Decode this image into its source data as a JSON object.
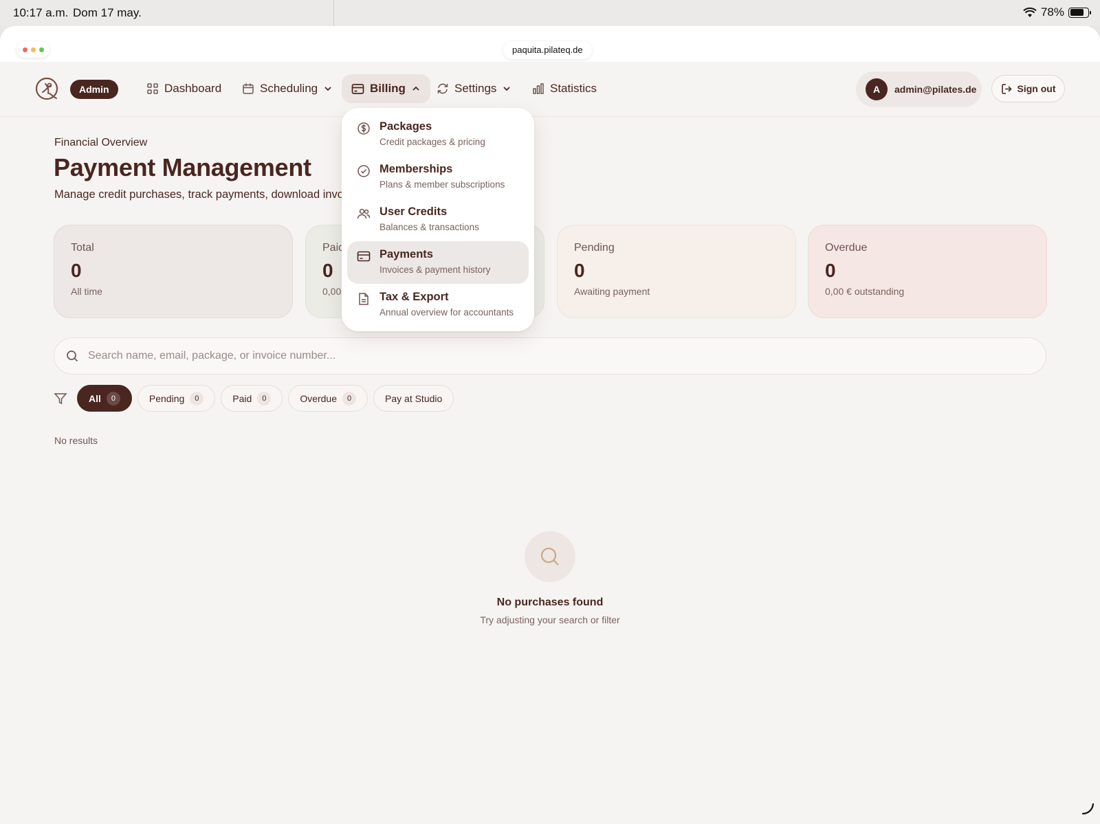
{
  "status_bar": {
    "time": "10:17 a.m.",
    "date": "Dom 17 may.",
    "battery": "78%"
  },
  "browser": {
    "url": "paquita.pilateq.de"
  },
  "nav": {
    "badge": "Admin",
    "items": [
      {
        "label": "Dashboard",
        "icon": "grid-icon"
      },
      {
        "label": "Scheduling",
        "icon": "calendar-icon"
      },
      {
        "label": "Billing",
        "icon": "credit-card-icon"
      },
      {
        "label": "Settings",
        "icon": "refresh-icon"
      },
      {
        "label": "Statistics",
        "icon": "bar-chart-icon"
      }
    ],
    "user_initial": "A",
    "user_email": "admin@pilates.de",
    "signout_label": "Sign out"
  },
  "billing_menu": [
    {
      "title": "Packages",
      "subtitle": "Credit packages & pricing",
      "icon": "dollar-icon"
    },
    {
      "title": "Memberships",
      "subtitle": "Plans & member subscriptions",
      "icon": "check-circle-icon"
    },
    {
      "title": "User Credits",
      "subtitle": "Balances & transactions",
      "icon": "users-icon"
    },
    {
      "title": "Payments",
      "subtitle": "Invoices & payment history",
      "icon": "credit-card-icon"
    },
    {
      "title": "Tax & Export",
      "subtitle": "Annual overview for accountants",
      "icon": "document-icon"
    }
  ],
  "page": {
    "eyebrow": "Financial Overview",
    "title": "Payment Management",
    "subtitle": "Manage credit purchases, track payments, download invo"
  },
  "stats": [
    {
      "label": "Total",
      "value": "0",
      "note": "All time"
    },
    {
      "label": "Paid",
      "value": "0",
      "note": "0,00 €"
    },
    {
      "label": "Pending",
      "value": "0",
      "note": "Awaiting payment"
    },
    {
      "label": "Overdue",
      "value": "0",
      "note": "0,00 € outstanding"
    }
  ],
  "search": {
    "placeholder": "Search name, email, package, or invoice number..."
  },
  "filters": [
    {
      "label": "All",
      "count": "0"
    },
    {
      "label": "Pending",
      "count": "0"
    },
    {
      "label": "Paid",
      "count": "0"
    },
    {
      "label": "Overdue",
      "count": "0"
    },
    {
      "label": "Pay at Studio",
      "count": ""
    }
  ],
  "results_text": "No results",
  "empty_state": {
    "title": "No purchases found",
    "subtitle": "Try adjusting your search or filter"
  },
  "colors": {
    "brand": "#4a2620",
    "background": "#f6f4f2",
    "pending_tint": "#f6ede6",
    "overdue_tint": "#f5e6e3"
  }
}
